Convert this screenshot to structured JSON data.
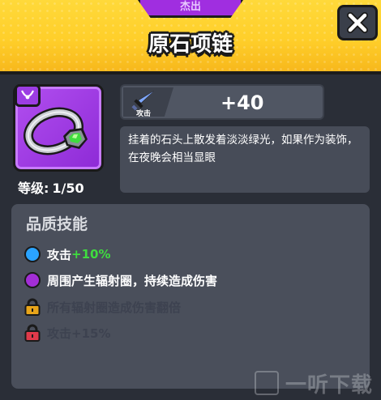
{
  "header": {
    "rarity_label": "杰出",
    "title": "原石项链"
  },
  "item": {
    "level_label": "等级:",
    "level_value": "1/50",
    "icon": "necklace-icon",
    "rarity_color": "#a436e6"
  },
  "stat": {
    "icon": "sword-icon",
    "label": "攻击",
    "value": "+40"
  },
  "description": "挂着的石头上散发着淡淡绿光，如果作为装饰，在夜晚会相当显眼",
  "skills": {
    "title": "品质技能",
    "rows": [
      {
        "text": "攻击",
        "bonus": "+10%",
        "dot_color": "#2aa3ff",
        "state": "unlocked"
      },
      {
        "text": "周围产生辐射圈，持续造成伤害",
        "dot_color": "#a22ed6",
        "state": "unlocked"
      },
      {
        "text": "所有辐射圈造成伤害翻倍",
        "lock_color": "#e8a51a",
        "state": "locked"
      },
      {
        "text": "攻击+15%",
        "lock_color": "#e03a4a",
        "state": "locked"
      }
    ]
  },
  "watermark": {
    "text": "一听下载"
  },
  "colors": {
    "header_yellow": "#ffd93a",
    "bonus_green": "#3fdc3f",
    "panel_bg": "#2a2e37"
  }
}
